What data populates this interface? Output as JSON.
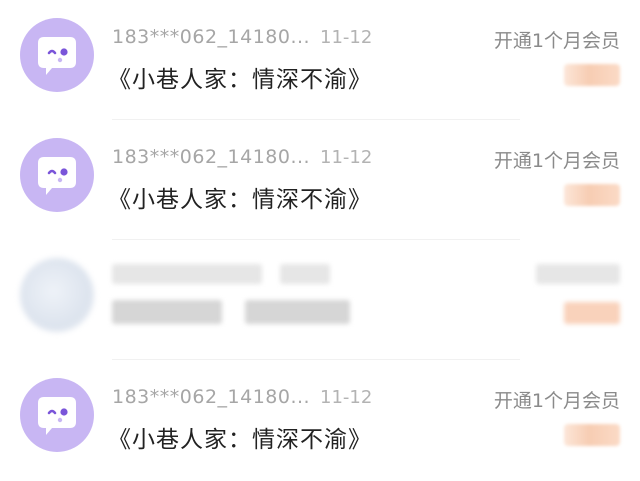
{
  "conversations": [
    {
      "username": "183***062_14180...",
      "date": "11-12",
      "message": "《小巷人家：情深不渝》",
      "status": "开通1个月会员",
      "price_censored": true
    },
    {
      "username": "183***062_14180...",
      "date": "11-12",
      "message": "《小巷人家：情深不渝》",
      "status": "开通1个月会员",
      "price_censored": true
    },
    {
      "censored": true
    },
    {
      "username": "183***062_14180...",
      "date": "11-12",
      "message": "《小巷人家：情深不渝》",
      "status": "开通1个月会员",
      "price_censored": true
    }
  ],
  "colors": {
    "avatar_bg": "#c8b6f3",
    "avatar_face": "#ffffff",
    "avatar_eye": "#7a55d9",
    "status_text": "#8a8a8a",
    "price_blur": "#f7cdb3"
  },
  "icons": {
    "avatar": "smiley-chat-bubble-icon"
  }
}
